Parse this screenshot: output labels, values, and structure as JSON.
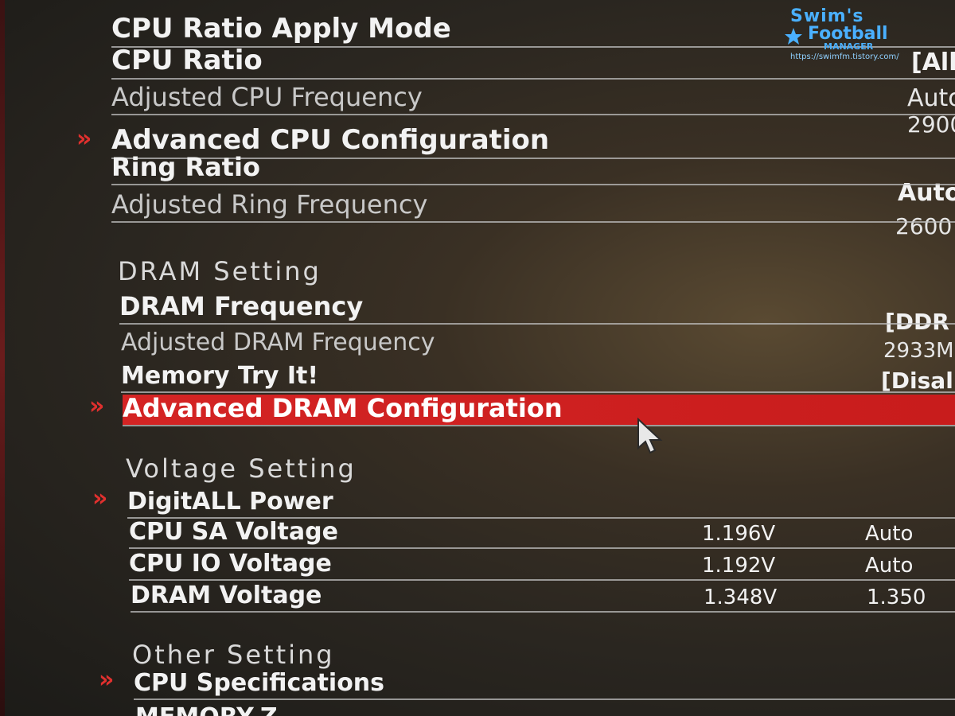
{
  "cpu": {
    "ratio_apply_mode": "CPU Ratio Apply Mode",
    "ratio": {
      "label": "CPU Ratio",
      "value": "[All"
    },
    "adj_freq": {
      "label": "Adjusted CPU Frequency",
      "value": "Auto"
    },
    "advanced": {
      "label": "Advanced CPU Configuration",
      "value": "2900"
    },
    "ring_ratio": {
      "label": "Ring Ratio",
      "value": "Auto"
    },
    "adj_ring": {
      "label": "Adjusted Ring Frequency",
      "value": "2600"
    }
  },
  "dram": {
    "section": "DRAM  Setting",
    "freq": {
      "label": "DRAM Frequency",
      "value": "[DDR"
    },
    "adj_freq": {
      "label": "Adjusted DRAM Frequency",
      "value": "2933M"
    },
    "try_it": {
      "label": "Memory Try It!",
      "value": "[Disal"
    },
    "advanced": {
      "label": "Advanced DRAM Configuration"
    }
  },
  "voltage": {
    "section": "Voltage  Setting",
    "digitall": {
      "label": "DigitALL Power"
    },
    "cpu_sa": {
      "label": "CPU SA Voltage",
      "current": "1.196V",
      "setting": "Auto"
    },
    "cpu_io": {
      "label": "CPU IO Voltage",
      "current": "1.192V",
      "setting": "Auto"
    },
    "dram_v": {
      "label": "DRAM Voltage",
      "current": "1.348V",
      "setting": "1.350"
    }
  },
  "other": {
    "section": "Other  Setting",
    "cpu_spec": {
      "label": "CPU Specifications"
    },
    "memory_z": {
      "label": "MEMORY-Z"
    }
  },
  "watermark": {
    "line1": "Swim's",
    "line2": "Football",
    "line3": "MANAGER",
    "url": "https://swimfm.tistory.com/"
  },
  "icons": {
    "submenu_arrow": "chevron-double-right",
    "pointer": "mouse-pointer-icon"
  },
  "colors": {
    "highlight": "#d42424",
    "arrow": "#e0302e",
    "watermark": "#4ab0ff"
  }
}
